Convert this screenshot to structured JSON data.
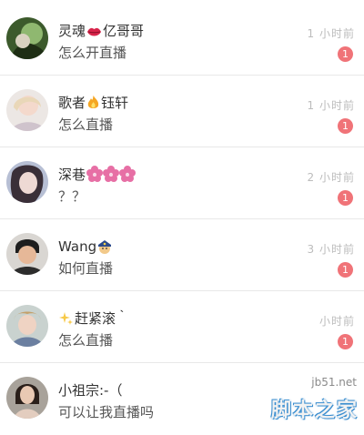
{
  "conversations": [
    {
      "name": "灵魂",
      "name_suffix": "亿哥哥",
      "message": "怎么开直播",
      "time": "1 小时前",
      "badge": "1",
      "emoji": "lips-icon"
    },
    {
      "name": "歌者",
      "name_suffix": "钰轩",
      "message": "怎么直播",
      "time": "1 小时前",
      "badge": "1",
      "emoji": "fire-icon"
    },
    {
      "name": "深巷",
      "name_suffix": "",
      "message": "？？",
      "time": "2 小时前",
      "badge": "1",
      "emoji": "flowers-icon"
    },
    {
      "name": "Wang",
      "name_suffix": "",
      "message": "如何直播",
      "time": "3 小时前",
      "badge": "1",
      "emoji": "police-icon"
    },
    {
      "name": "",
      "name_suffix": "赶紧滚｀",
      "message": "怎么直播",
      "time": "小时前",
      "badge": "1",
      "emoji": "sparkles-icon"
    },
    {
      "name": "小祖宗:-（",
      "name_suffix": "",
      "message": "可以让我直播吗",
      "time": "",
      "badge": "",
      "emoji": ""
    }
  ],
  "watermark": {
    "url": "jb51.net",
    "text": "脚本之家"
  },
  "colors": {
    "badge": "#f07378",
    "time": "#bcbcbc",
    "divider": "#e8e8e8"
  }
}
